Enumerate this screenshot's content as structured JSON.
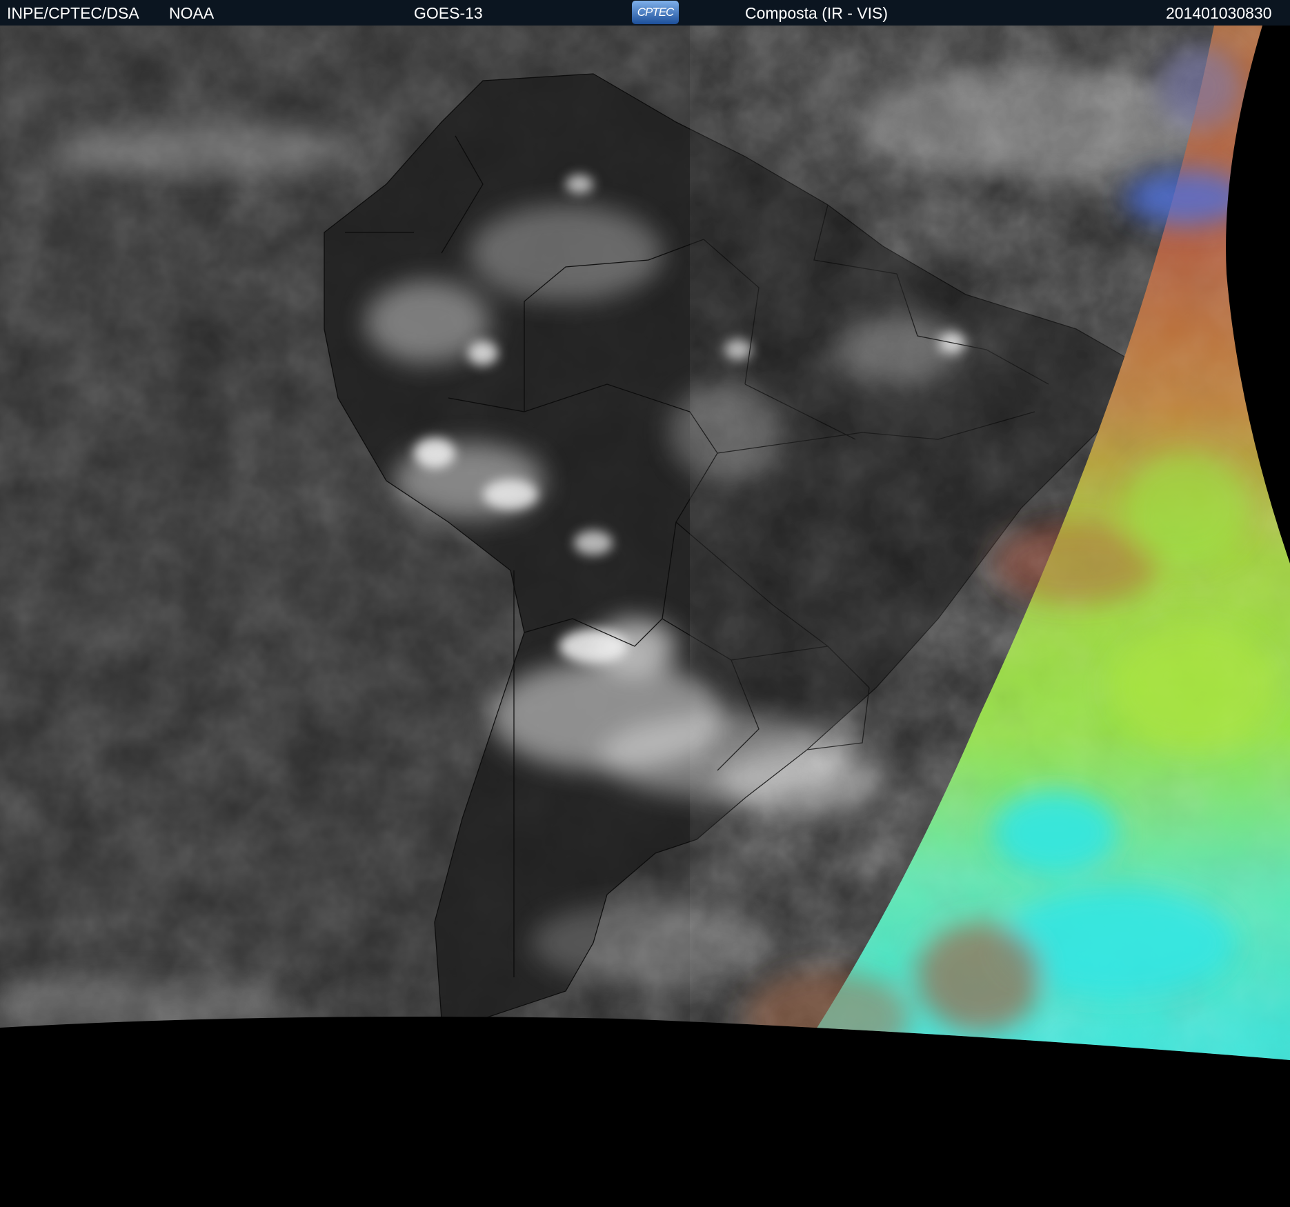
{
  "header": {
    "agency": "INPE/CPTEC/DSA",
    "source": "NOAA",
    "satellite": "GOES-13",
    "logo_text": "CPTEC",
    "product": "Composta (IR - VIS)",
    "timestamp": "201401030830"
  },
  "image": {
    "description": "satellite composite over South America",
    "colors": {
      "ir_background": "#2b2b2b",
      "land_dark": "#222222",
      "space": "#000000",
      "vis_green": "#9be33f",
      "vis_cyan": "#2fe6e0",
      "vis_red": "#b5533a",
      "vis_blue": "#4a6fe0"
    }
  }
}
